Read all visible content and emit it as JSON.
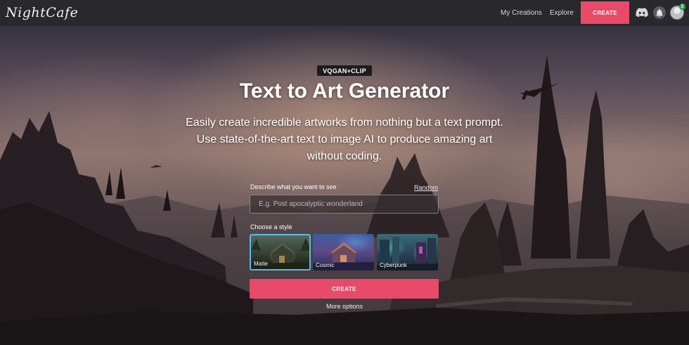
{
  "nav": {
    "logo_text": "NightCafe",
    "links": [
      {
        "label": "My Creations"
      },
      {
        "label": "Explore"
      }
    ],
    "create_label": "CREATE",
    "notification_count": "2",
    "icons": [
      "discord-icon",
      "bell-icon",
      "avatar"
    ]
  },
  "hero": {
    "badge": "VQGAN+CLIP",
    "title": "Text to Art Generator",
    "subtitle_lines": [
      "Easily create incredible artworks from nothing but a text prompt.",
      "Use state-of-the-art text to image AI to produce amazing art",
      "without coding."
    ]
  },
  "form": {
    "prompt_label": "Describe what you want to see",
    "random_label": "Random",
    "prompt_placeholder": "E.g. Post apocalyptic wonderland",
    "prompt_value": "",
    "style_label": "Choose a style",
    "styles": [
      {
        "name": "Matte",
        "selected": true
      },
      {
        "name": "Cosmic",
        "selected": false
      },
      {
        "name": "Cyberpunk",
        "selected": false
      }
    ],
    "create_label": "CREATE",
    "more_options_label": "More options"
  },
  "colors": {
    "accent": "#e84a6a",
    "nav_bg": "#28282d",
    "selected_border": "#5db9e8",
    "badge_green": "#2f9d57"
  }
}
